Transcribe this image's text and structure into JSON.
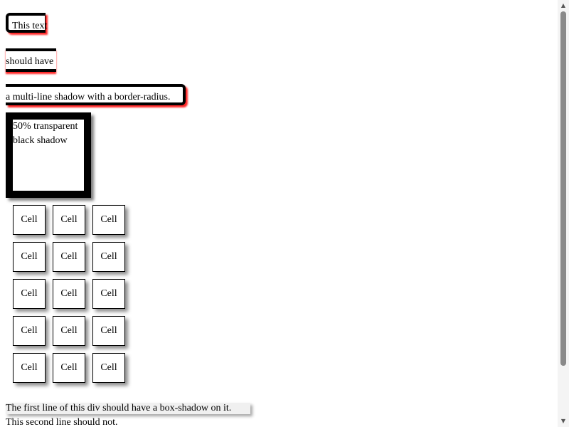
{
  "shadow_text": {
    "line1": "This text",
    "line2": "should have",
    "line3": "a multi-line shadow with a border-radius."
  },
  "transparent_box": {
    "line1": "50% transparent",
    "line2": "black shadow"
  },
  "cells": [
    "Cell",
    "Cell",
    "Cell",
    "Cell",
    "Cell",
    "Cell",
    "Cell",
    "Cell",
    "Cell",
    "Cell",
    "Cell",
    "Cell",
    "Cell",
    "Cell",
    "Cell"
  ],
  "footer": {
    "first_line": "The first line of this div should have a box-shadow on it.",
    "second_line": "This second line should not."
  },
  "colors": {
    "shadow_red": "#ff0000",
    "border_black": "#000000",
    "scrollbar_thumb": "#8a8a8a"
  },
  "scrollbar": {
    "up_icon": "arrow-up-icon",
    "down_icon": "arrow-down-icon"
  }
}
